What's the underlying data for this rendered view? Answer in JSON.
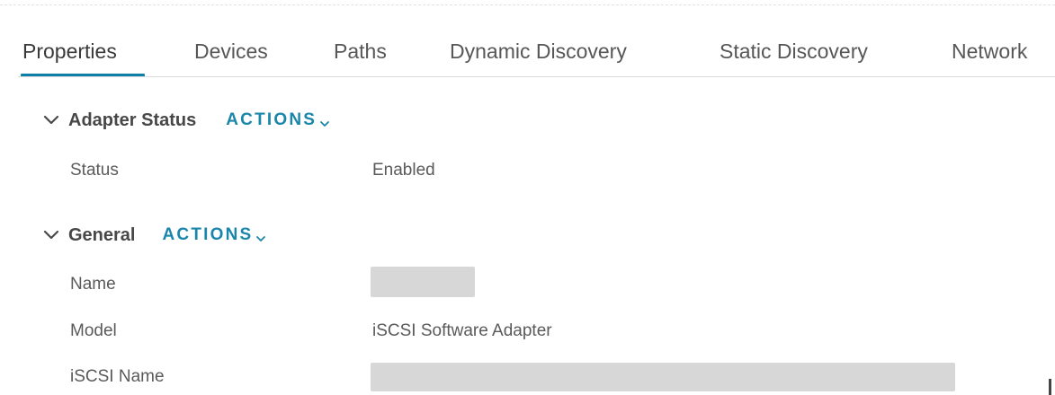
{
  "tabs": [
    {
      "label": "Properties",
      "active": true
    },
    {
      "label": "Devices",
      "active": false
    },
    {
      "label": "Paths",
      "active": false
    },
    {
      "label": "Dynamic Discovery",
      "active": false
    },
    {
      "label": "Static Discovery",
      "active": false
    },
    {
      "label": "Network",
      "active": false
    }
  ],
  "sections": {
    "adapter_status": {
      "title": "Adapter Status",
      "actions_label": "ACTIONS",
      "rows": [
        {
          "label": "Status",
          "value": "Enabled"
        }
      ]
    },
    "general": {
      "title": "General",
      "actions_label": "ACTIONS",
      "rows": [
        {
          "label": "Name",
          "value": ""
        },
        {
          "label": "Model",
          "value": "iSCSI Software Adapter"
        },
        {
          "label": "iSCSI Name",
          "value": ""
        }
      ]
    }
  },
  "colors": {
    "accent": "#1a86aa",
    "tab_underline": "#0e7fa8",
    "redacted": "#d7d7d7"
  },
  "icons": {
    "section_toggle": "chevron-down-icon",
    "actions_caret": "caret-down-icon"
  }
}
